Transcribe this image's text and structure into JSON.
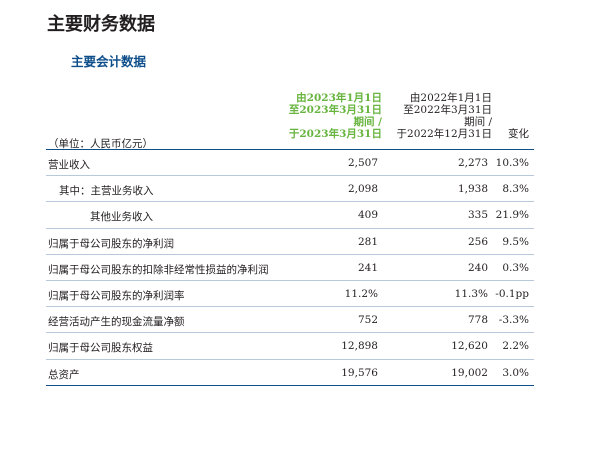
{
  "page_title": "主要财务数据",
  "section_title": "主要会计数据",
  "header": {
    "current_period": [
      "由2023年1月1日",
      "至2023年3月31日",
      "期间 /",
      "于2023年3月31日"
    ],
    "prior_period": [
      "由2022年1月1日",
      "至2022年3月31日",
      "期间 /",
      "于2022年12月31日"
    ],
    "change": "变化",
    "unit": "（单位：人民币亿元）"
  },
  "rows": [
    {
      "label": "营业收入",
      "current": "2,507",
      "prior": "2,273",
      "change": "10.3%"
    },
    {
      "label": "其中：主营业务收入",
      "current": "2,098",
      "prior": "1,938",
      "change": "8.3%"
    },
    {
      "label": "其他业务收入",
      "current": "409",
      "prior": "335",
      "change": "21.9%"
    },
    {
      "label": "归属于母公司股东的净利润",
      "current": "281",
      "prior": "256",
      "change": "9.5%"
    },
    {
      "label": "归属于母公司股东的扣除非经常性损益的净利润",
      "current": "241",
      "prior": "240",
      "change": "0.3%"
    },
    {
      "label": "归属于母公司股东的净利润率",
      "current": "11.2%",
      "prior": "11.3%",
      "change": "-0.1pp"
    },
    {
      "label": "经营活动产生的现金流量净额",
      "current": "752",
      "prior": "778",
      "change": "-3.3%"
    },
    {
      "label": "归属于母公司股东权益",
      "current": "12,898",
      "prior": "12,620",
      "change": "2.2%"
    },
    {
      "label": "总资产",
      "current": "19,576",
      "prior": "19,002",
      "change": "3.0%"
    }
  ],
  "colors": {
    "accent": "#0e4f8b",
    "current_period": "#67b43e",
    "text": "#231f20",
    "rule": "#b9c9d9"
  }
}
